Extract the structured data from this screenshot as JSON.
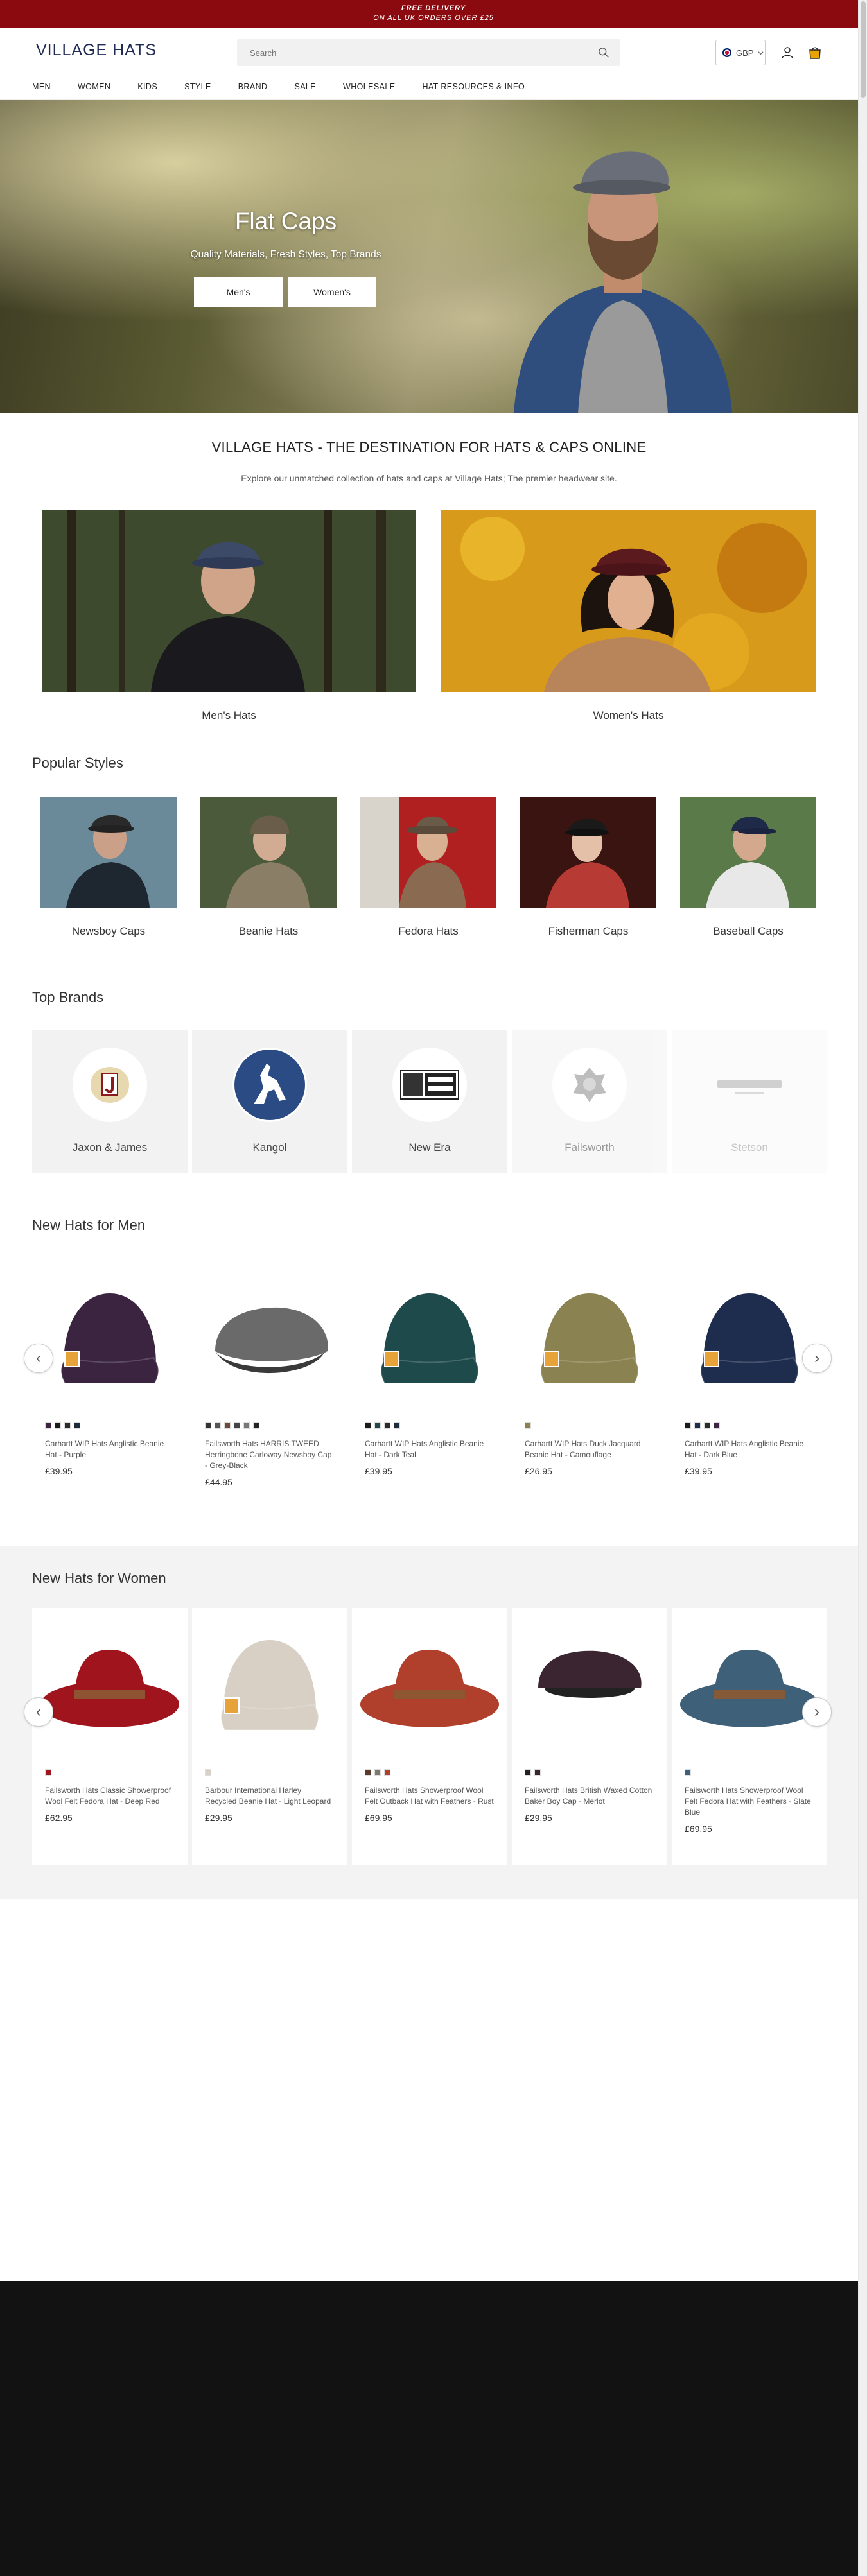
{
  "banner": {
    "line1": "FREE DELIVERY",
    "line2": "ON ALL UK ORDERS OVER £25"
  },
  "header": {
    "logo": "VILLAGE HATS",
    "search_placeholder": "Search",
    "currency": "GBP",
    "nav": [
      "MEN",
      "WOMEN",
      "KIDS",
      "STYLE",
      "BRAND",
      "SALE",
      "WHOLESALE",
      "HAT RESOURCES & INFO"
    ]
  },
  "hero": {
    "title": "Flat Caps",
    "subtitle": "Quality Materials, Fresh Styles, Top Brands",
    "buttons": [
      "Men's",
      "Women's"
    ]
  },
  "intro": {
    "title": "VILLAGE HATS - THE DESTINATION FOR HATS & CAPS ONLINE",
    "subtitle": "Explore our unmatched collection of hats and caps at Village Hats; The premier headwear site."
  },
  "categories": [
    "Men's Hats",
    "Women's Hats"
  ],
  "popular_styles": {
    "title": "Popular Styles",
    "items": [
      "Newsboy Caps",
      "Beanie Hats",
      "Fedora Hats",
      "Fisherman Caps",
      "Baseball Caps"
    ]
  },
  "top_brands": {
    "title": "Top Brands",
    "items": [
      "Jaxon & James",
      "Kangol",
      "New Era",
      "Failsworth",
      "Stetson"
    ]
  },
  "new_men": {
    "title": "New Hats for Men",
    "products": [
      {
        "name": "Carhartt WIP Hats Anglistic Beanie Hat - Purple",
        "price": "£39.95",
        "color": "#3a2440",
        "swatches": [
          "#3a2440",
          "#1a1a1a",
          "#2a2a2a",
          "#1d2a3a"
        ]
      },
      {
        "name": "Failsworth Hats HARRIS TWEED Herringbone Carloway Newsboy Cap - Grey-Black",
        "price": "£44.95",
        "color": "#6a6a6a",
        "swatches": [
          "#333333",
          "#555555",
          "#6b4a3a",
          "#444444",
          "#777777",
          "#222222"
        ]
      },
      {
        "name": "Carhartt WIP Hats Anglistic Beanie Hat - Dark Teal",
        "price": "£39.95",
        "color": "#1f4a4c",
        "swatches": [
          "#1a1a1a",
          "#1f4a4c",
          "#2a2a2a",
          "#1d2a3a"
        ]
      },
      {
        "name": "Carhartt WIP Hats Duck Jacquard Beanie Hat - Camouflage",
        "price": "£26.95",
        "color": "#8a8250",
        "swatches": [
          "#8a8250"
        ]
      },
      {
        "name": "Carhartt WIP Hats Anglistic Beanie Hat - Dark Blue",
        "price": "£39.95",
        "color": "#1e2c4e",
        "swatches": [
          "#1a1a1a",
          "#1e2c4e",
          "#2a2a2a",
          "#3a2440"
        ]
      }
    ]
  },
  "new_women": {
    "title": "New Hats for Women",
    "products": [
      {
        "name": "Failsworth Hats Classic Showerproof Wool Felt Fedora Hat - Deep Red",
        "price": "£62.95",
        "color": "#a0141e",
        "swatches": [
          "#a0141e"
        ]
      },
      {
        "name": "Barbour International Harley Recycled Beanie Hat - Light Leopard",
        "price": "£29.95",
        "color": "#d8d0c4",
        "swatches": [
          "#d8d0c4"
        ]
      },
      {
        "name": "Failsworth Hats Showerproof Wool Felt Outback Hat with Feathers - Rust",
        "price": "£69.95",
        "color": "#b0402c",
        "swatches": [
          "#5a3a2a",
          "#7a7a6a",
          "#b0402c"
        ]
      },
      {
        "name": "Failsworth Hats British Waxed Cotton Baker Boy Cap - Merlot",
        "price": "£29.95",
        "color": "#3a2530",
        "swatches": [
          "#222222",
          "#3a2530"
        ]
      },
      {
        "name": "Failsworth Hats Showerproof Wool Felt Fedora Hat with Feathers - Slate Blue",
        "price": "£69.95",
        "color": "#3e6078",
        "swatches": [
          "#3e6078"
        ]
      }
    ]
  }
}
